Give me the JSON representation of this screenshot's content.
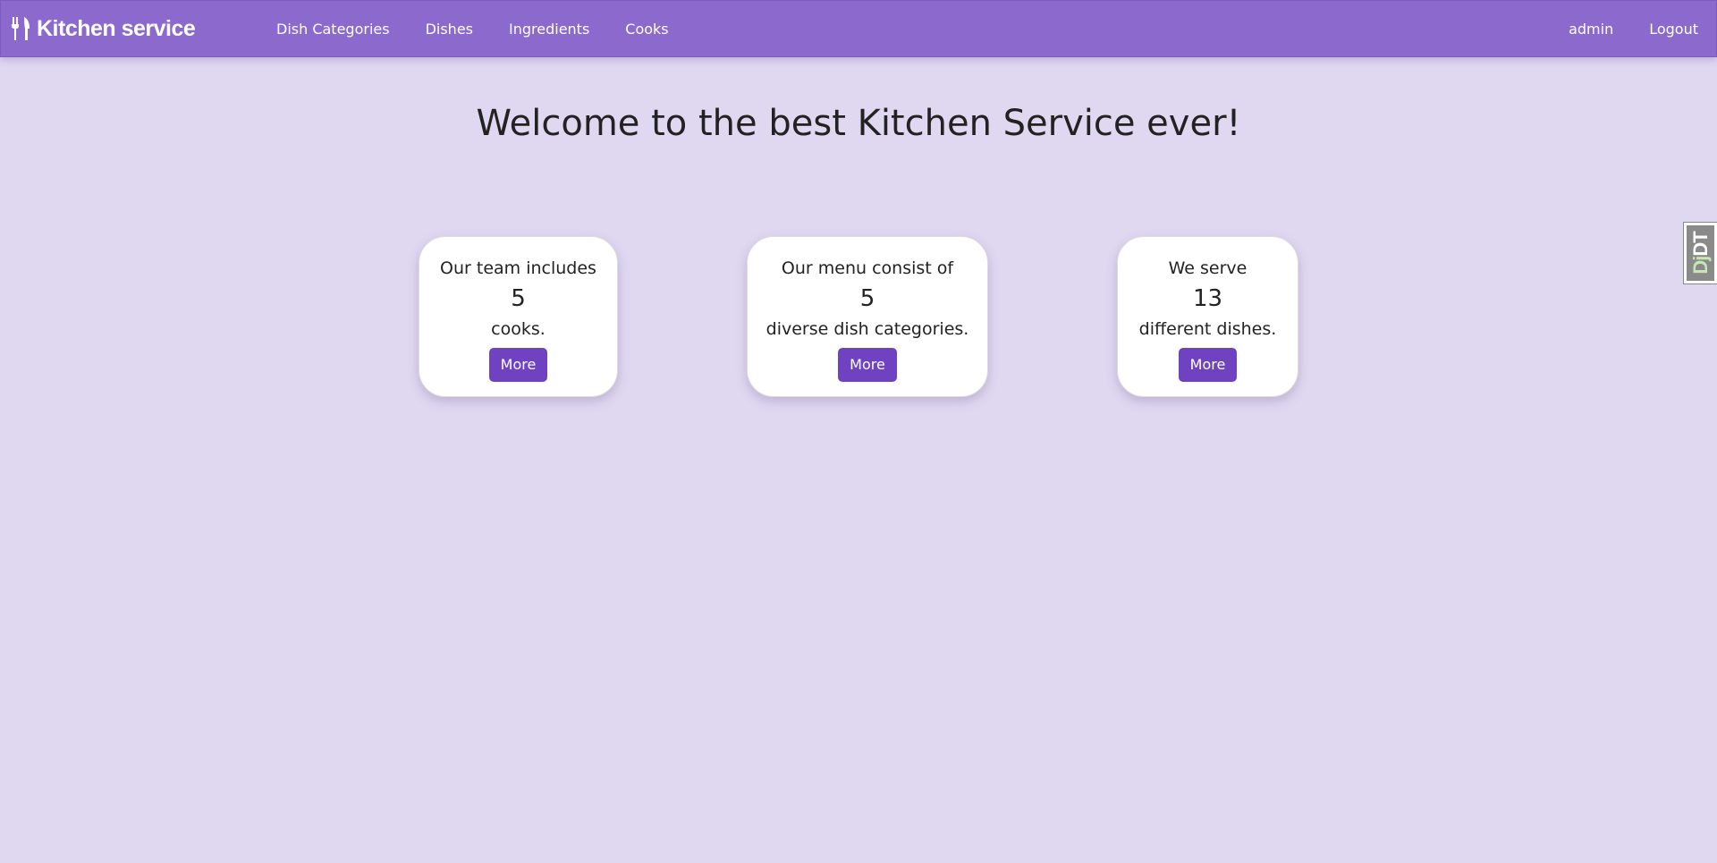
{
  "navbar": {
    "brand": {
      "icon": "fork-knife-icon",
      "label": "Kitchen service"
    },
    "links": [
      {
        "label": "Dish Categories"
      },
      {
        "label": "Dishes"
      },
      {
        "label": "Ingredients"
      },
      {
        "label": "Cooks"
      }
    ],
    "user": "admin",
    "logout_label": "Logout"
  },
  "main": {
    "title": "Welcome to the best Kitchen Service ever!",
    "cards": [
      {
        "top": "Our team includes",
        "count": "5",
        "bottom": "cooks.",
        "button": "More"
      },
      {
        "top": "Our menu consist of",
        "count": "5",
        "bottom": "diverse dish categories.",
        "button": "More"
      },
      {
        "top": "We serve",
        "count": "13",
        "bottom": "different dishes.",
        "button": "More"
      }
    ]
  },
  "debug_toolbar": {
    "handle_prefix": "Dj",
    "handle_suffix": "DT"
  },
  "colors": {
    "page_background": "#e0d8f1",
    "navbar": "#8c69cc",
    "button": "#6f42c1"
  }
}
